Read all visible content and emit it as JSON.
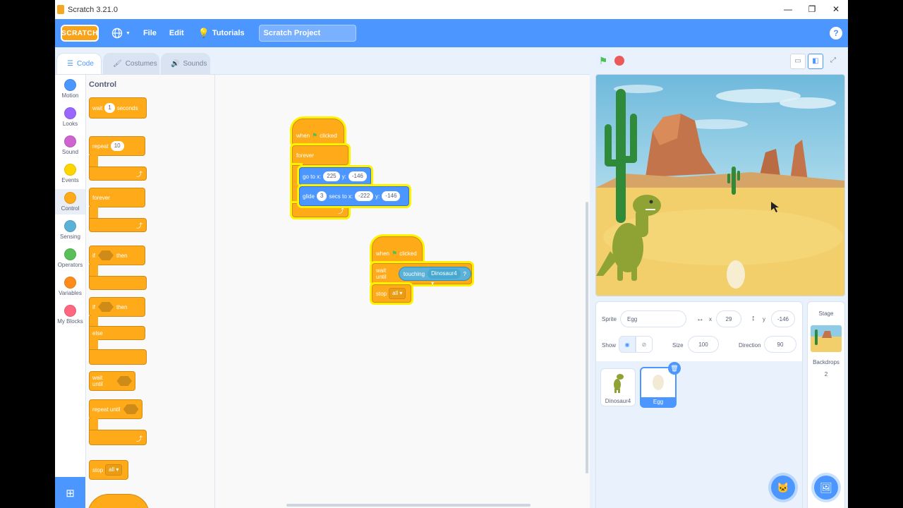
{
  "window": {
    "title": "Scratch 3.21.0",
    "controls": [
      "—",
      "❐",
      "✕"
    ]
  },
  "menubar": {
    "logo": "SCRATCH",
    "file": "File",
    "edit": "Edit",
    "tutorials": "Tutorials",
    "project_title": "Scratch Project",
    "help": "?"
  },
  "tabs": {
    "code": "Code",
    "costumes": "Costumes",
    "sounds": "Sounds"
  },
  "categories": [
    {
      "label": "Motion",
      "color": "#4c97ff"
    },
    {
      "label": "Looks",
      "color": "#9966ff"
    },
    {
      "label": "Sound",
      "color": "#cf63cf"
    },
    {
      "label": "Events",
      "color": "#ffd500"
    },
    {
      "label": "Control",
      "color": "#ffab19"
    },
    {
      "label": "Sensing",
      "color": "#5cb1d6"
    },
    {
      "label": "Operators",
      "color": "#59c059"
    },
    {
      "label": "Variables",
      "color": "#ff8c1a"
    },
    {
      "label": "My Blocks",
      "color": "#ff6680"
    }
  ],
  "palette": {
    "title": "Control",
    "wait": "wait",
    "wait_val": "1",
    "seconds": "seconds",
    "repeat": "repeat",
    "repeat_val": "10",
    "forever": "forever",
    "if": "if",
    "then": "then",
    "if2": "if",
    "then2": "then",
    "else": "else",
    "wait_until": "wait until",
    "repeat_until": "repeat until",
    "stop": "stop",
    "stop_val": "all"
  },
  "script1": {
    "hat_when": "when",
    "hat_clicked": "clicked",
    "forever": "forever",
    "goto": "go to x:",
    "goto_x": "225",
    "goto_y_lbl": "y:",
    "goto_y": "-146",
    "glide": "glide",
    "glide_secs": "3",
    "glide_to": "secs to x:",
    "glide_x": "-222",
    "glide_y_lbl": "y:",
    "glide_y": "-146"
  },
  "script2": {
    "hat_when": "when",
    "hat_clicked": "clicked",
    "wait_until": "wait until",
    "touching": "touching",
    "touching_target": "Dinosaur4 ▾",
    "q": "?",
    "stop": "stop",
    "stop_val": "all ▾"
  },
  "zoom": {
    "in": "+",
    "out": "−",
    "reset": "="
  },
  "sprite_info": {
    "sprite_label": "Sprite",
    "sprite_name": "Egg",
    "x_label": "x",
    "x_val": "29",
    "y_label": "y",
    "y_val": "-146",
    "show_label": "Show",
    "size_label": "Size",
    "size_val": "100",
    "direction_label": "Direction",
    "direction_val": "90"
  },
  "sprites": [
    {
      "name": "Dinosaur4"
    },
    {
      "name": "Egg"
    }
  ],
  "stage_panel": {
    "title": "Stage",
    "backdrops_label": "Backdrops",
    "backdrops_count": "2"
  }
}
